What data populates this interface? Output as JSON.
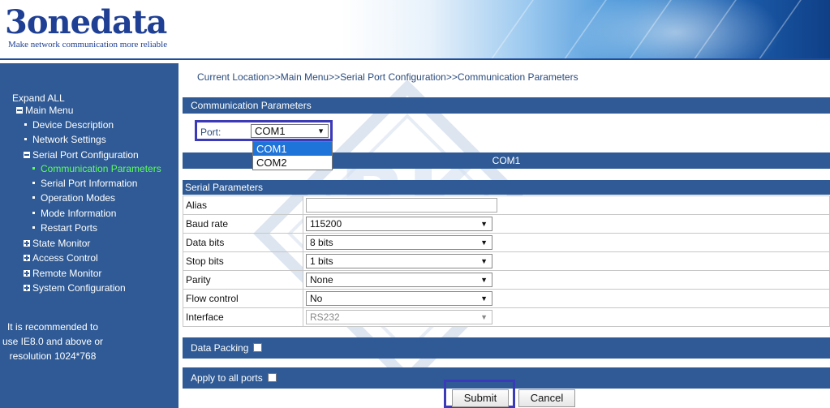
{
  "header": {
    "logo_text": "3onedata",
    "slogan": "Make network communication more reliable"
  },
  "sidebar": {
    "expand_all": "Expand ALL",
    "main_menu": "Main Menu",
    "items": [
      {
        "label": "Device Description"
      },
      {
        "label": "Network Settings"
      },
      {
        "label": "Serial Port Configuration"
      },
      {
        "label": "Communication Parameters"
      },
      {
        "label": "Serial Port Information"
      },
      {
        "label": "Operation Modes"
      },
      {
        "label": "Mode Information"
      },
      {
        "label": "Restart Ports"
      },
      {
        "label": "State Monitor"
      },
      {
        "label": "Access Control"
      },
      {
        "label": "Remote Monitor"
      },
      {
        "label": "System Configuration"
      }
    ],
    "recommend": [
      "It is recommended to",
      "use IE8.0 and above or",
      "resolution 1024*768"
    ]
  },
  "content": {
    "breadcrumb": "Current Location>>Main Menu>>Serial Port Configuration>>Communication Parameters",
    "comm_title": "Communication Parameters",
    "port_label": "Port:",
    "port_selected": "COM1",
    "port_options": [
      "COM1",
      "COM2"
    ],
    "com_header": "COM1",
    "serial_title": "Serial Parameters",
    "params": [
      {
        "label": "Alias",
        "value": ""
      },
      {
        "label": "Baud rate",
        "value": "115200"
      },
      {
        "label": "Data bits",
        "value": "8 bits"
      },
      {
        "label": "Stop bits",
        "value": "1 bits"
      },
      {
        "label": "Parity",
        "value": "None"
      },
      {
        "label": "Flow control",
        "value": "No"
      },
      {
        "label": "Interface",
        "value": "RS232"
      }
    ],
    "data_packing": "Data Packing",
    "apply_all": "Apply to all ports",
    "submit": "Submit",
    "cancel": "Cancel"
  },
  "watermark_text": "BK AII",
  "colors": {
    "sidebar_bg": "#2f5a95",
    "active_item": "#5dff5d",
    "highlight_box": "#3b3ab8"
  }
}
